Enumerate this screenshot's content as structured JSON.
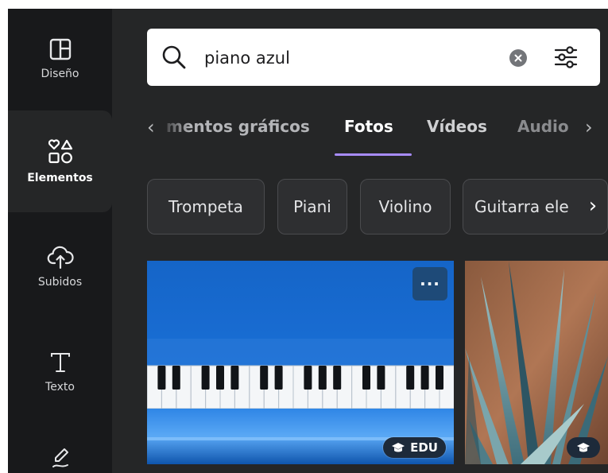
{
  "sidebar": {
    "items": [
      {
        "label": "Diseño",
        "icon": "layout-icon"
      },
      {
        "label": "Elementos",
        "icon": "shapes-icon"
      },
      {
        "label": "Subidos",
        "icon": "cloud-upload-icon"
      },
      {
        "label": "Texto",
        "icon": "text-icon"
      },
      {
        "label": "",
        "icon": "draw-icon"
      }
    ],
    "active": "Elementos"
  },
  "search": {
    "value": "piano azul",
    "icons": [
      "search-icon",
      "clear-icon",
      "filters-icon"
    ]
  },
  "tabs": {
    "items": [
      "mentos gráficos",
      "Fotos",
      "Vídeos",
      "Audio"
    ],
    "active": "Fotos"
  },
  "chips": [
    "Trompeta",
    "Piani",
    "Violino",
    "Guitarra ele"
  ],
  "photos": [
    {
      "badge": "EDU",
      "more_label": "···"
    },
    {
      "badge": ""
    }
  ],
  "colors": {
    "panel_bg": "#252627",
    "sidebar_bg": "#18191b",
    "accent_underline": "#a78bfa",
    "badge_bg": "#1d2a3a"
  }
}
